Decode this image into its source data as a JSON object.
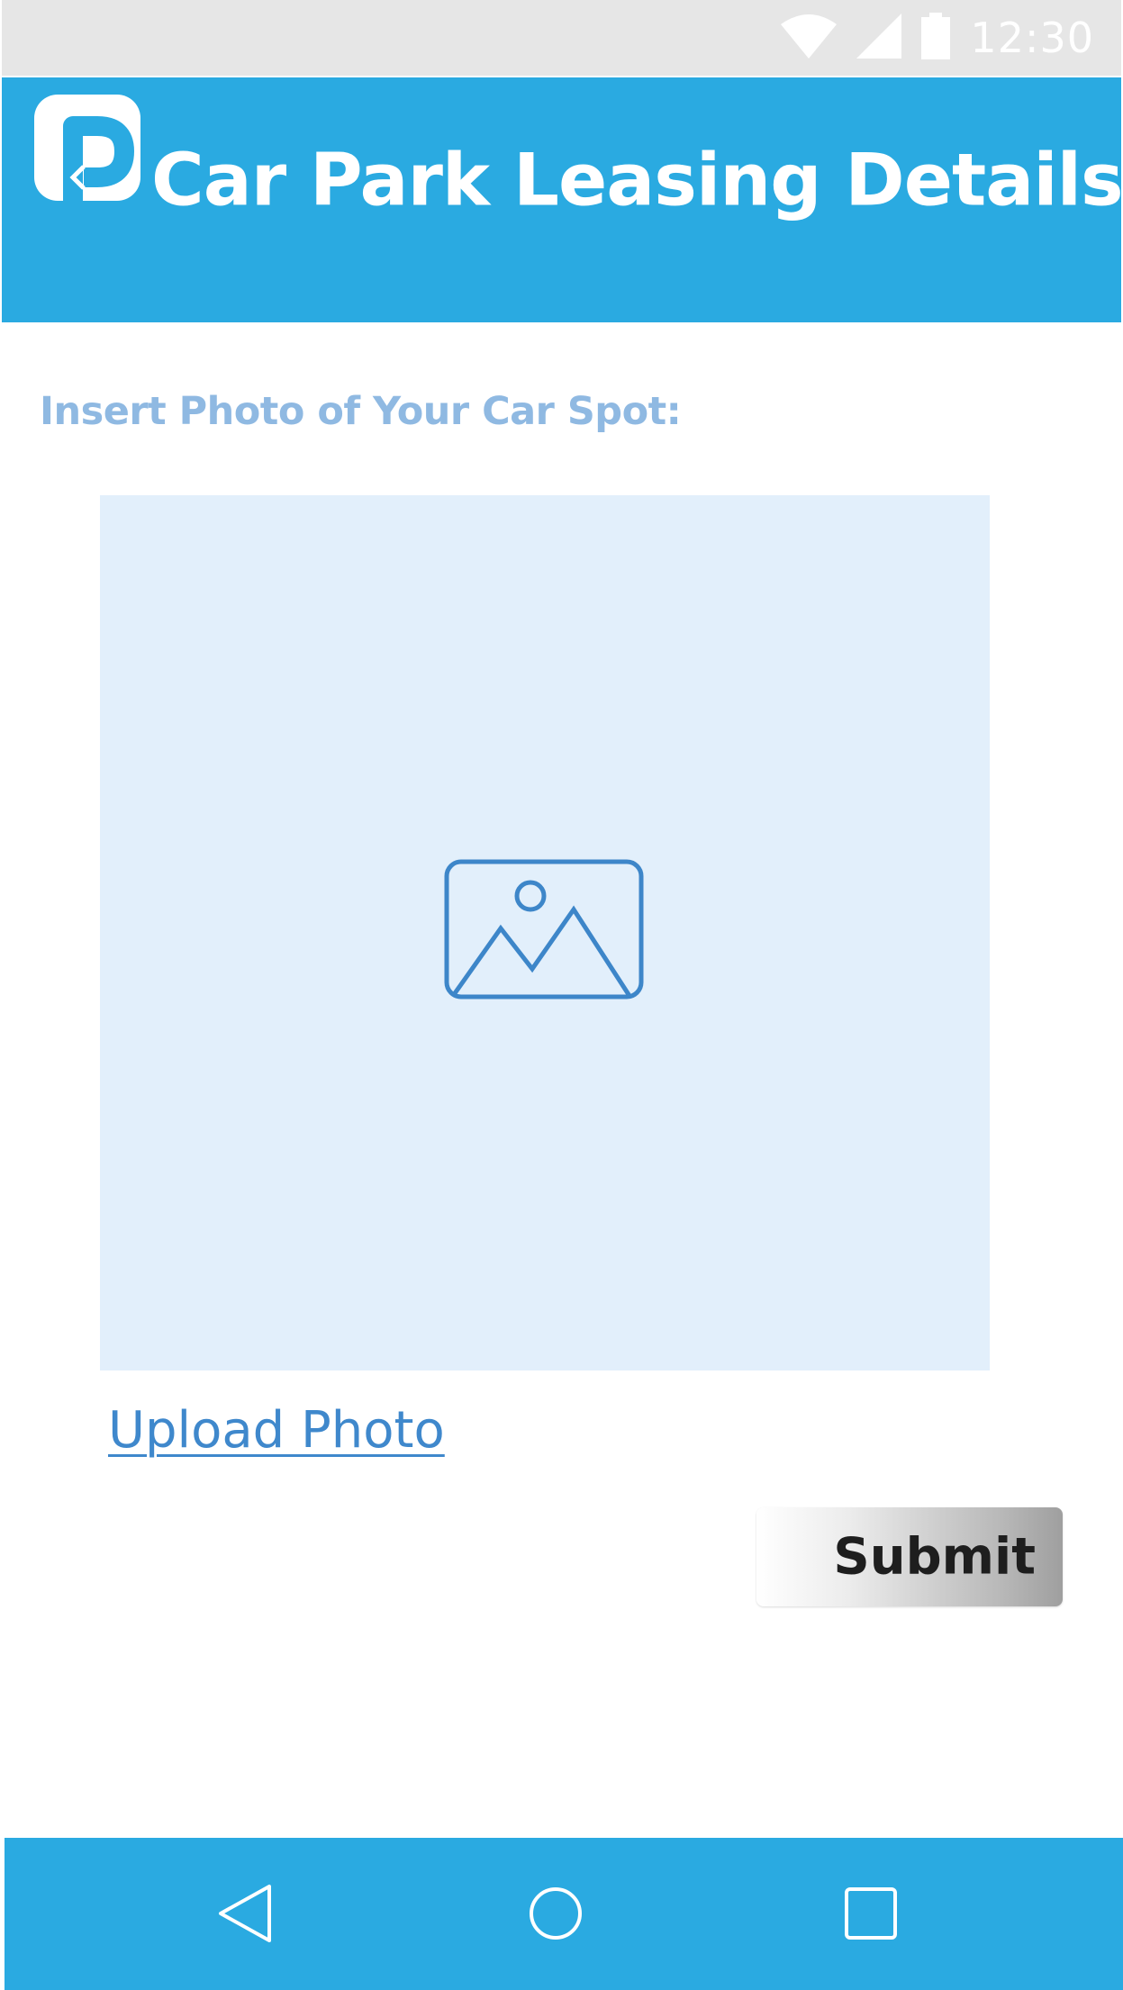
{
  "status_bar": {
    "time": "12:30",
    "icons": [
      "wifi-icon",
      "signal-icon",
      "battery-icon"
    ]
  },
  "header": {
    "logo_icon": "parking-logo-icon",
    "title": "Car Park Leasing Details"
  },
  "form": {
    "photo_label": "Insert Photo of Your Car Spot:",
    "photo_placeholder_icon": "image-placeholder-icon",
    "upload_link": "Upload Photo",
    "submit_label": "Submit"
  },
  "nav_bar": {
    "buttons": [
      "back-icon",
      "home-icon",
      "recents-icon"
    ]
  },
  "colors": {
    "primary": "#2aaae1",
    "status_bar_bg": "#e6e6e6",
    "label_text": "#8fb9e2",
    "placeholder_bg": "#e2effb",
    "placeholder_icon": "#3d86c9",
    "link": "#3f88cc"
  }
}
